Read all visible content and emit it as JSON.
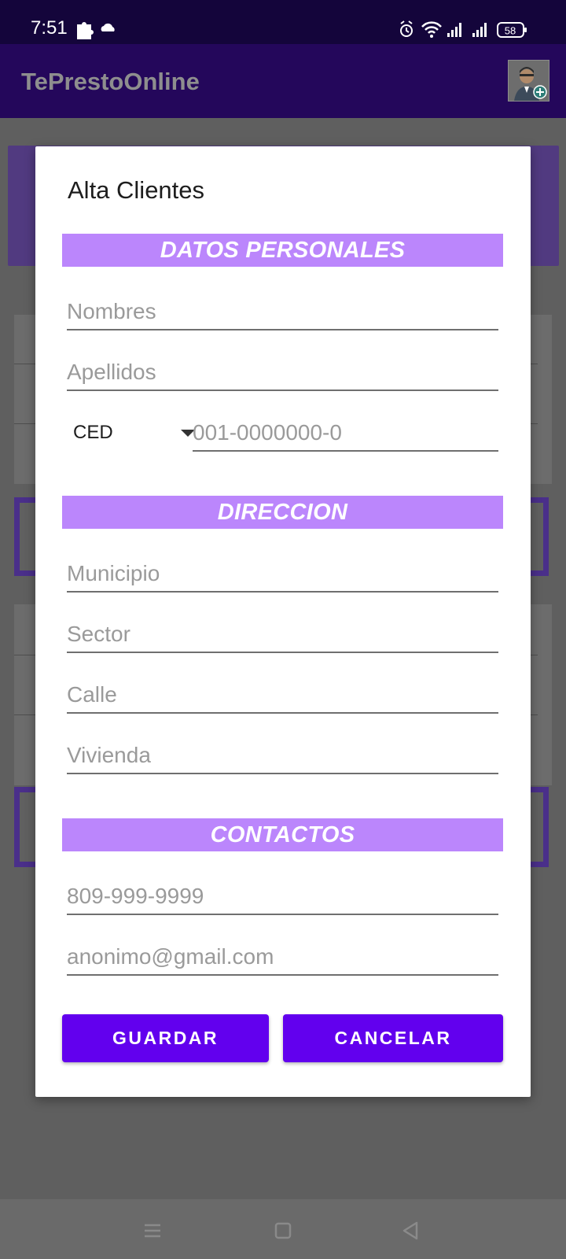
{
  "status_bar": {
    "time": "7:51",
    "battery": "58"
  },
  "app_bar": {
    "title": "TePrestoOnline",
    "avatar_icon": "add-user-avatar-icon"
  },
  "dialog": {
    "title": "Alta Clientes",
    "sections": {
      "personal": "DATOS PERSONALES",
      "address": "DIRECCION",
      "contacts": "CONTACTOS"
    },
    "fields": {
      "nombres": {
        "placeholder": "Nombres",
        "value": ""
      },
      "apellidos": {
        "placeholder": "Apellidos",
        "value": ""
      },
      "doc_type": {
        "selected": "CED"
      },
      "doc_number": {
        "placeholder": "001-0000000-0",
        "value": ""
      },
      "municipio": {
        "placeholder": "Municipio",
        "value": ""
      },
      "sector": {
        "placeholder": "Sector",
        "value": ""
      },
      "calle": {
        "placeholder": "Calle",
        "value": ""
      },
      "vivienda": {
        "placeholder": "Vivienda",
        "value": ""
      },
      "telefono": {
        "placeholder": "809-999-9999",
        "value": ""
      },
      "email": {
        "placeholder": "anonimo@gmail.com",
        "value": ""
      }
    },
    "buttons": {
      "save": "GUARDAR",
      "cancel": "CANCELAR"
    }
  },
  "colors": {
    "primary": "#6200ee",
    "section_header": "#bb86fc",
    "app_bar": "#24075b",
    "status_bar": "#14053b"
  }
}
